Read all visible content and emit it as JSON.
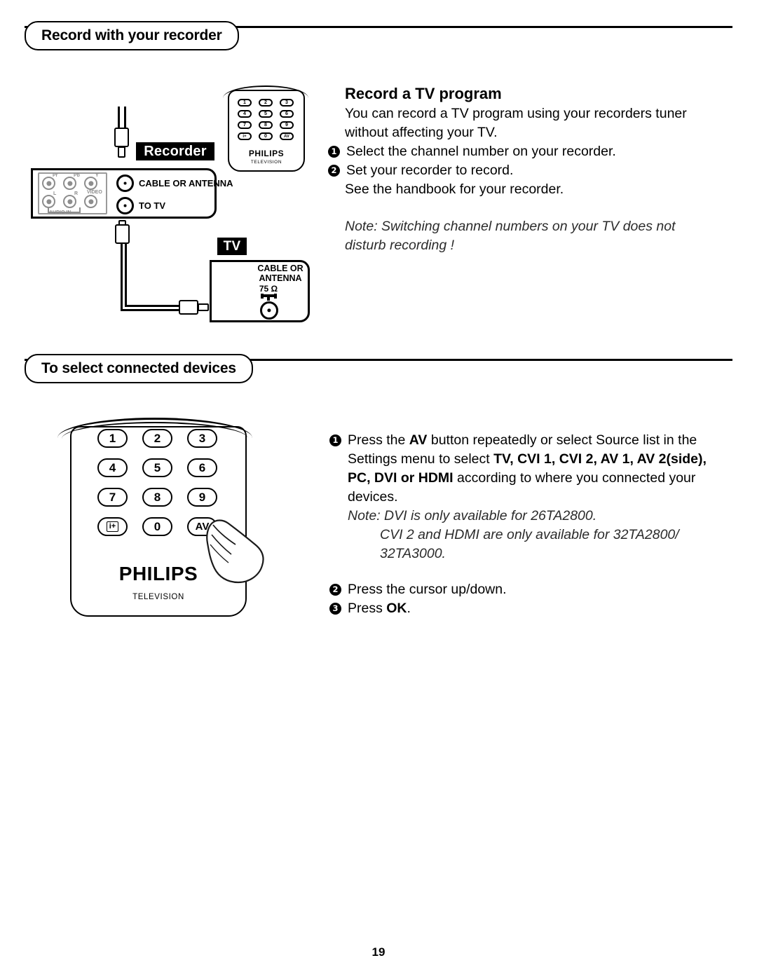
{
  "page": {
    "number": "19"
  },
  "section1": {
    "header": "Record with your recorder",
    "subheading": "Record a TV program",
    "intro": "You can record a TV program using your recorders tuner without affecting your TV.",
    "steps": [
      {
        "marker": "1",
        "text": "Select the channel number on your recorder."
      },
      {
        "marker": "2",
        "text": "Set your recorder to record."
      }
    ],
    "extra_line": "See the handbook for your recorder.",
    "note": "Note: Switching channel numbers on your TV does not disturb recording !",
    "diagram": {
      "recorder_tag": "Recorder",
      "tv_tag": "TV",
      "recorder_jacks": [
        {
          "label": "CABLE OR ANTENNA"
        },
        {
          "label": "TO TV"
        }
      ],
      "av_jacks": [
        {
          "label": "Pr"
        },
        {
          "label": "Pb"
        },
        {
          "label": "Y"
        },
        {
          "label": "L"
        },
        {
          "label": "R"
        },
        {
          "label": "VIDEO"
        }
      ],
      "audio_in_label": "AUDIO IN",
      "tv_jack_label_line1": "CABLE OR",
      "tv_jack_label_line2": "ANTENNA",
      "tv_impedance": "75 Ω"
    },
    "small_remote": {
      "keys": [
        "1",
        "2",
        "3",
        "4",
        "5",
        "6",
        "7",
        "8",
        "9",
        "i+",
        "0",
        "AV"
      ],
      "brand": "PHILIPS",
      "sub_brand": "TELEVISION"
    }
  },
  "section2": {
    "header": "To select connected devices",
    "steps": [
      {
        "marker": "1",
        "part1": "Press the ",
        "bold1": "AV",
        "part2": " button repeatedly or select Source list in the Settings menu to select ",
        "bold2": "TV, CVI 1, CVI 2,  AV 1, AV 2(side), PC, DVI or HDMI",
        "part3": "  according to where you connected your devices."
      },
      {
        "marker": "2",
        "text": "Press the cursor up/down."
      },
      {
        "marker": "3",
        "part1": "Press ",
        "bold1": "OK",
        "part2": "."
      }
    ],
    "note_line1": "Note: DVI is only available for 26TA2800.",
    "note_line2": "CVI 2 and HDMI are only available for 32TA2800/",
    "note_line3": "32TA3000.",
    "remote": {
      "keys": [
        "1",
        "2",
        "3",
        "4",
        "5",
        "6",
        "7",
        "8",
        "9",
        "i+",
        "0",
        "AV"
      ],
      "brand": "PHILIPS",
      "sub_brand": "TELEVISION"
    }
  }
}
